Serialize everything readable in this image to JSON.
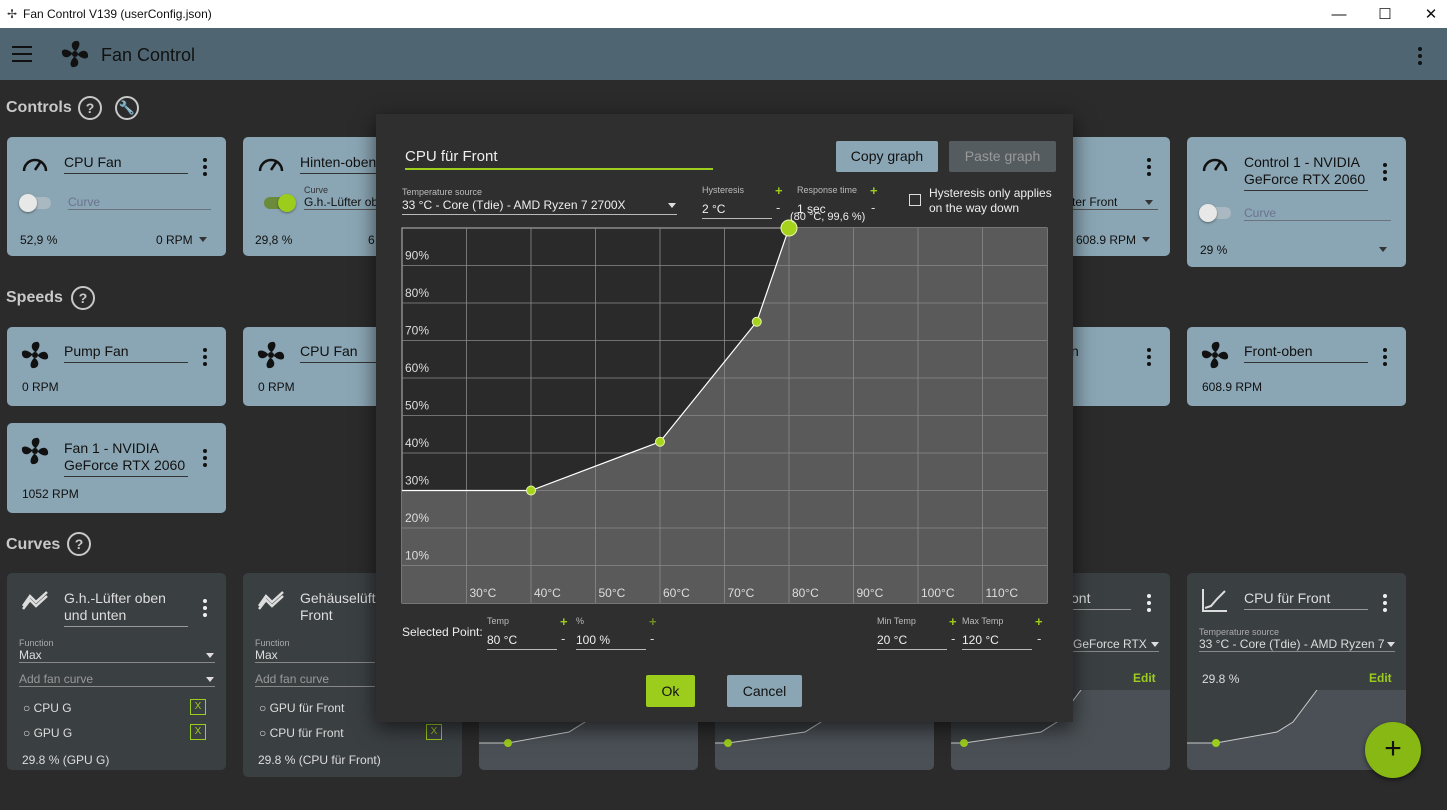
{
  "window": {
    "title": "Fan Control V139 (userConfig.json)",
    "minimize": "—",
    "maximize": "☐",
    "close": "✕"
  },
  "appbar": {
    "title": "Fan Control"
  },
  "sections": {
    "controls": "Controls",
    "speeds": "Speeds",
    "curves": "Curves",
    "help": "?",
    "wrench": "🔧"
  },
  "controls": [
    {
      "title": "CPU Fan",
      "curve_value": "Curve",
      "percent": "52,9 %",
      "rpm": "0 RPM",
      "toggle": "off"
    },
    {
      "title": "Hinten-oben",
      "curve_label": "Curve",
      "curve_value": "G.h.-Lüfter ob",
      "percent": "29,8 %",
      "rpm": "6",
      "toggle": "on"
    },
    {
      "title": "",
      "curve_value": "ter Front",
      "rpm": "608.9 RPM"
    },
    {
      "title": "Control 1 - NVIDIA GeForce RTX 2060",
      "curve_value": "Curve",
      "percent": "29 %",
      "toggle": "off"
    }
  ],
  "speeds": [
    {
      "title": "Pump Fan",
      "rpm": "0 RPM"
    },
    {
      "title": "CPU Fan",
      "rpm": "0 RPM"
    },
    {
      "title": "n"
    },
    {
      "title": "Front-oben",
      "rpm": "608.9 RPM"
    },
    {
      "title": "Fan 1 - NVIDIA GeForce RTX 2060",
      "rpm": "1052 RPM"
    }
  ],
  "curves": [
    {
      "title": "G.h.-Lüfter oben und unten",
      "function_label": "Function",
      "function_value": "Max",
      "add_label": "Add fan curve",
      "items": [
        "CPU G",
        "GPU G"
      ],
      "remove": "X",
      "status": "29.8 % (GPU G)"
    },
    {
      "title": "Gehäuselüft Front",
      "function_label": "Function",
      "function_value": "Max",
      "add_label": "Add fan curve",
      "items": [
        "GPU für Front",
        "CPU für Front"
      ],
      "remove": "X",
      "status": "29.8 % (CPU für Front)"
    },
    {
      "title": "ont",
      "source_value": "GeForce RTX",
      "edit": "Edit"
    },
    {
      "title": "CPU für Front",
      "source_label": "Temperature source",
      "source_value": "33 °C - Core (Tdie) - AMD Ryzen 7",
      "percent": "29.8 %",
      "edit": "Edit"
    }
  ],
  "dialog": {
    "name": "CPU für Front",
    "copy_graph": "Copy graph",
    "paste_graph": "Paste graph",
    "temp_source_label": "Temperature source",
    "temp_source_value": "33 °C - Core (Tdie) - AMD Ryzen 7 2700X",
    "hysteresis_label": "Hysteresis",
    "hysteresis_value": "2 °C",
    "response_label": "Response time",
    "response_value": "1 sec",
    "hyst_checkbox": "Hysteresis only applies on the way down",
    "plus": "+",
    "minus": "-",
    "selected_point_label": "Selected Point:",
    "temp_label": "Temp",
    "temp_value": "80 °C",
    "pct_label": "%",
    "pct_value": "100 %",
    "min_temp_label": "Min Temp",
    "min_temp_value": "20 °C",
    "max_temp_label": "Max Temp",
    "max_temp_value": "120 °C",
    "ok": "Ok",
    "cancel": "Cancel"
  },
  "chart_data": {
    "type": "line",
    "xlim": [
      20,
      120
    ],
    "ylim": [
      0,
      100
    ],
    "x_ticks": [
      30,
      40,
      50,
      60,
      70,
      80,
      90,
      100,
      110
    ],
    "x_tick_labels": [
      "30°C",
      "40°C",
      "50°C",
      "60°C",
      "70°C",
      "80°C",
      "90°C",
      "100°C",
      "110°C"
    ],
    "y_ticks": [
      10,
      20,
      30,
      40,
      50,
      60,
      70,
      80,
      90
    ],
    "y_tick_labels": [
      "10%",
      "20%",
      "30%",
      "40%",
      "50%",
      "60%",
      "70%",
      "80%",
      "90%"
    ],
    "points": [
      {
        "x": 40,
        "y": 30
      },
      {
        "x": 60,
        "y": 43
      },
      {
        "x": 75,
        "y": 75
      },
      {
        "x": 80,
        "y": 100
      }
    ],
    "flat_start_y": 30,
    "selected_index": 3,
    "selected_label": "(80 °C, 99,6 %)",
    "grid": true,
    "colors": {
      "line": "#ffffff",
      "point": "#a6d41c",
      "fill": "#5a5a5a"
    }
  },
  "colors": {
    "accent": "#9ccc1c",
    "card": "#8aa5b3",
    "appbar": "#4f6672"
  }
}
